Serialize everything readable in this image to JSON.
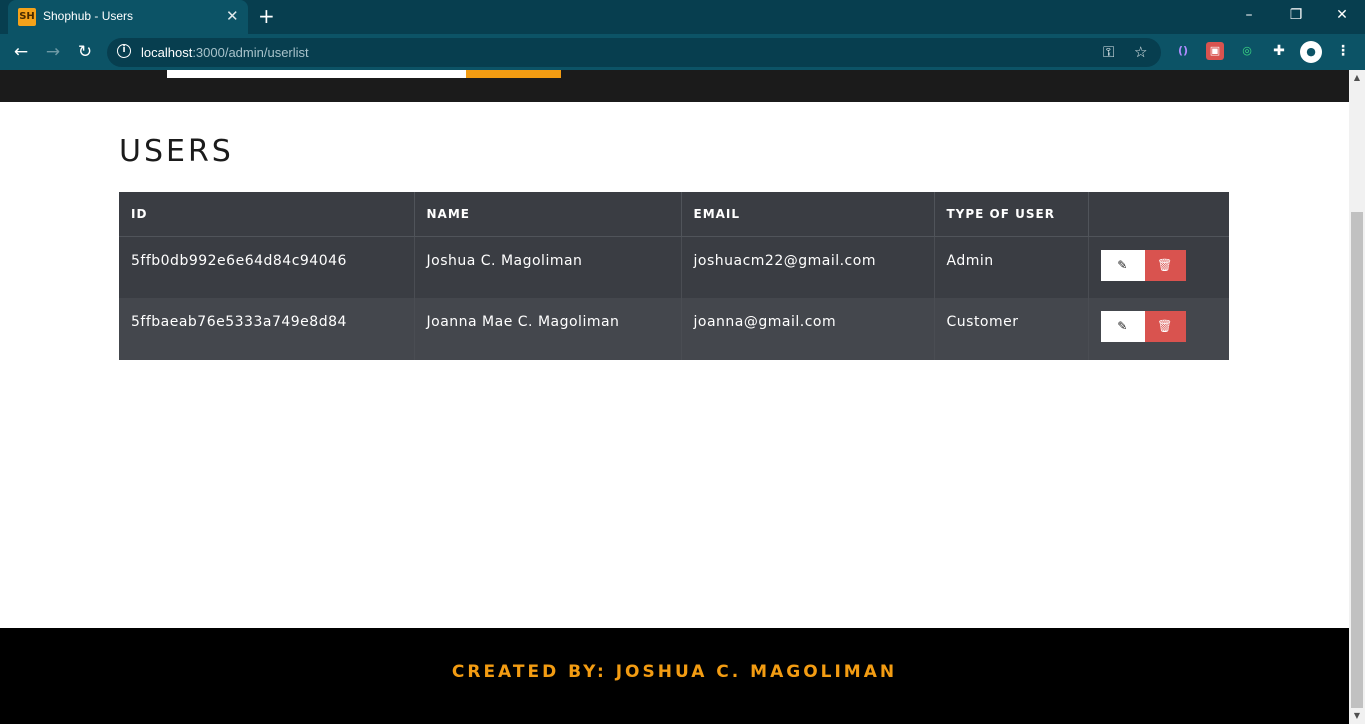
{
  "browser": {
    "tab": {
      "favicon_text": "SH",
      "title": "Shophub - Users"
    },
    "url": {
      "host": "localhost",
      "path": ":3000/admin/userlist"
    }
  },
  "page": {
    "title": "USERS",
    "table": {
      "headers": [
        "ID",
        "NAME",
        "EMAIL",
        "TYPE OF USER",
        ""
      ],
      "rows": [
        {
          "id": "5ffb0db992e6e64d84c94046",
          "name": "Joshua C. Magoliman",
          "email": "joshuacm22@gmail.com",
          "type": "Admin"
        },
        {
          "id": "5ffbaeab76e5333a749e8d84",
          "name": "Joanna Mae C. Magoliman",
          "email": "joanna@gmail.com",
          "type": "Customer"
        }
      ]
    },
    "footer": {
      "text": "CREATED BY: JOSHUA C. MAGOLIMAN"
    }
  },
  "colors": {
    "accent": "#f39c12",
    "danger": "#d9534f",
    "table_bg": "#3a3d43",
    "header_bg": "#1b1b1b"
  },
  "icons": {
    "edit": "edit-icon",
    "delete": "trash-icon",
    "back": "back-arrow-icon",
    "forward": "forward-arrow-icon",
    "reload": "reload-icon",
    "key": "key-icon",
    "star": "star-icon"
  }
}
